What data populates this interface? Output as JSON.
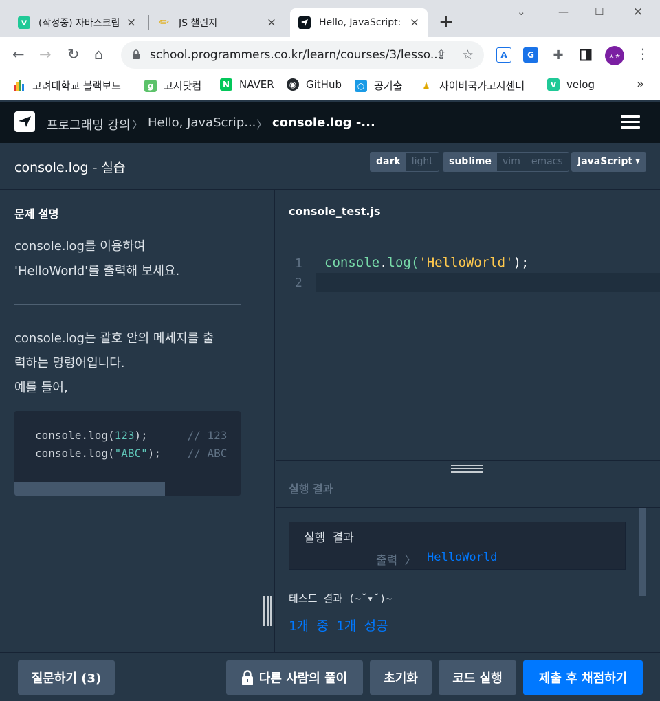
{
  "browser": {
    "tabs": [
      {
        "title": "(작성중) 자바스크립",
        "icon": "velog",
        "close": "×"
      },
      {
        "title": "JS 챌린지",
        "icon": "pencil",
        "close": "×"
      },
      {
        "title": "Hello, JavaScript: ",
        "icon": "programmers",
        "close": "×"
      }
    ],
    "new_tab": "+",
    "url": "school.programmers.co.kr/learn/courses/3/lesso...",
    "profile_initials": "ㅅㅎ",
    "bookmarks": [
      {
        "label": "고려대학교 블랙보드"
      },
      {
        "label": "고시닷컴"
      },
      {
        "label": "NAVER"
      },
      {
        "label": "GitHub"
      },
      {
        "label": "공기출"
      },
      {
        "label": "사이버국가고시센터"
      },
      {
        "label": "velog"
      }
    ],
    "bookmarks_more": "»"
  },
  "nav": {
    "breadcrumbs": [
      "프로그래밍 강의",
      "Hello, JavaScrip...",
      "console.log -..."
    ]
  },
  "header": {
    "title": "console.log - 실습",
    "theme_options": [
      "dark",
      "light"
    ],
    "keymap_options": [
      "sublime",
      "vim",
      "emacs"
    ],
    "language": "JavaScript"
  },
  "problem": {
    "heading": "문제 설명",
    "intro_lines": [
      "console.log를 이용하여",
      "'HelloWorld'를 출력해 보세요."
    ],
    "body_lines": [
      "console.log는 괄호 안의 메세지를 출",
      "력하는 명령어입니다.",
      "예를 들어,"
    ],
    "example": {
      "line1": {
        "pre": "console.log(",
        "arg": "123",
        "post": ");      ",
        "comment": "// 123"
      },
      "line2": {
        "pre": "console.log(",
        "arg": "\"ABC\"",
        "post": ");    ",
        "comment": "// ABC"
      }
    }
  },
  "editor": {
    "filename": "console_test.js",
    "line_numbers": [
      "1",
      "2"
    ],
    "code": {
      "ident": "console",
      "dot": ".",
      "method": "log(",
      "str": "'HelloWorld'",
      "end": ");"
    }
  },
  "results": {
    "heading": "실행 결과",
    "box_title": "실행 결과",
    "output_label": "출력 〉",
    "output_value": "HelloWorld",
    "test_title": "테스트 결과 (~˘▾˘)~",
    "test_summary": "1개 중 1개 성공"
  },
  "footer": {
    "ask": "질문하기 (3)",
    "others": "다른 사람의 풀이",
    "reset": "초기화",
    "run": "코드 실행",
    "submit": "제출 후 채점하기"
  },
  "colors": {
    "accent": "#0078ff",
    "panel": "#263747",
    "nav": "#0c151c"
  }
}
